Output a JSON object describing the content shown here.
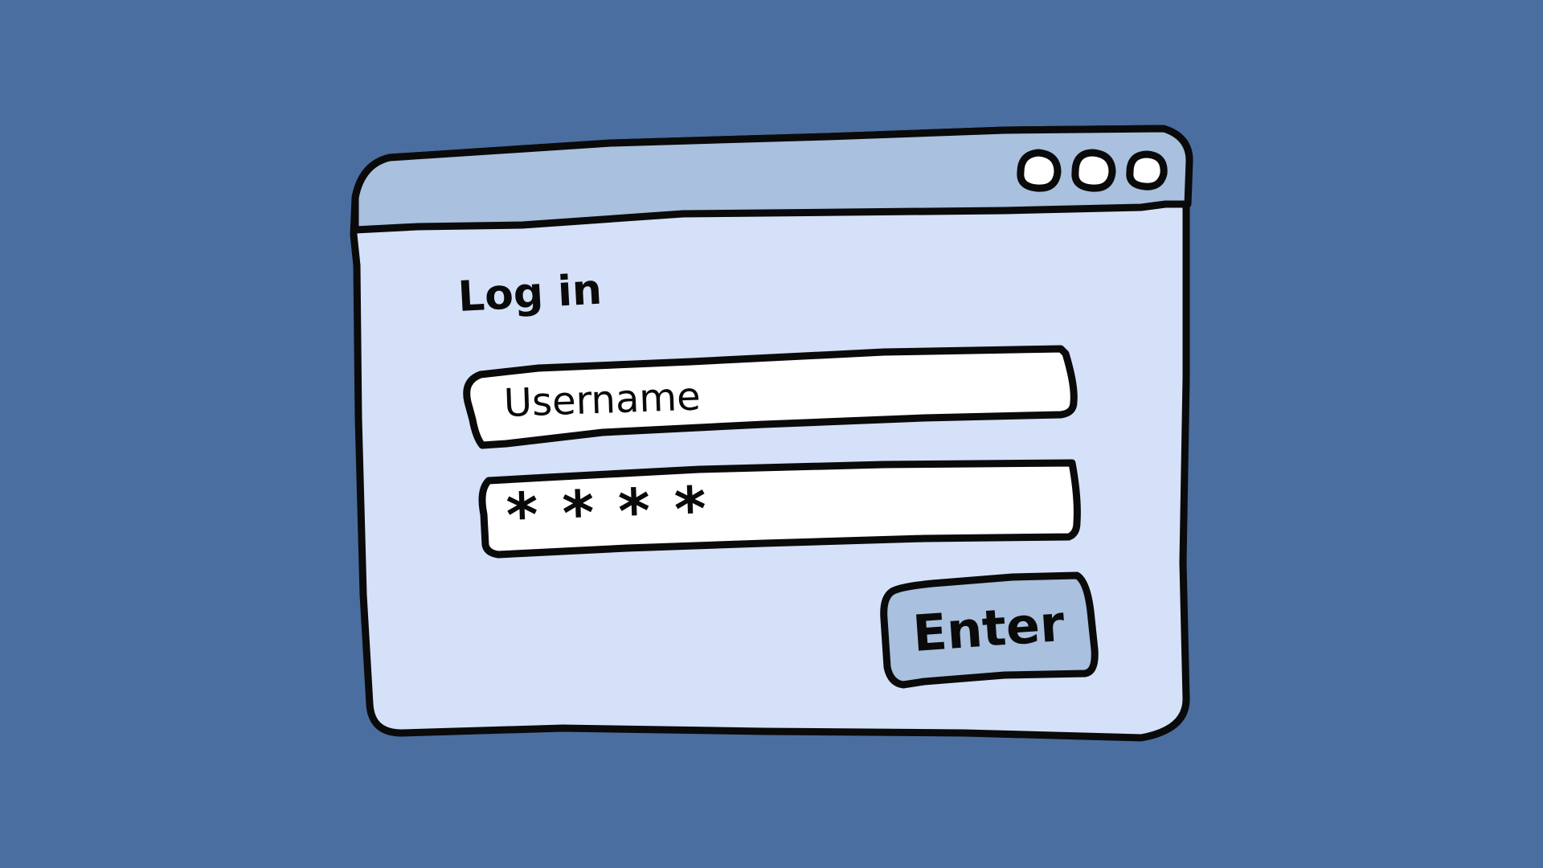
{
  "dialog": {
    "title": "Log in",
    "username_placeholder": "Username",
    "password_value": "****",
    "enter_label": "Enter",
    "window_controls": [
      "circle-icon",
      "circle-icon",
      "circle-icon"
    ]
  },
  "colors": {
    "background": "#4a6e9f",
    "titlebar": "#a9c0de",
    "window_body": "#d5e1f8",
    "input_fill": "#ffffff",
    "button_fill": "#a9c0de",
    "outline": "#0a0a0a"
  }
}
